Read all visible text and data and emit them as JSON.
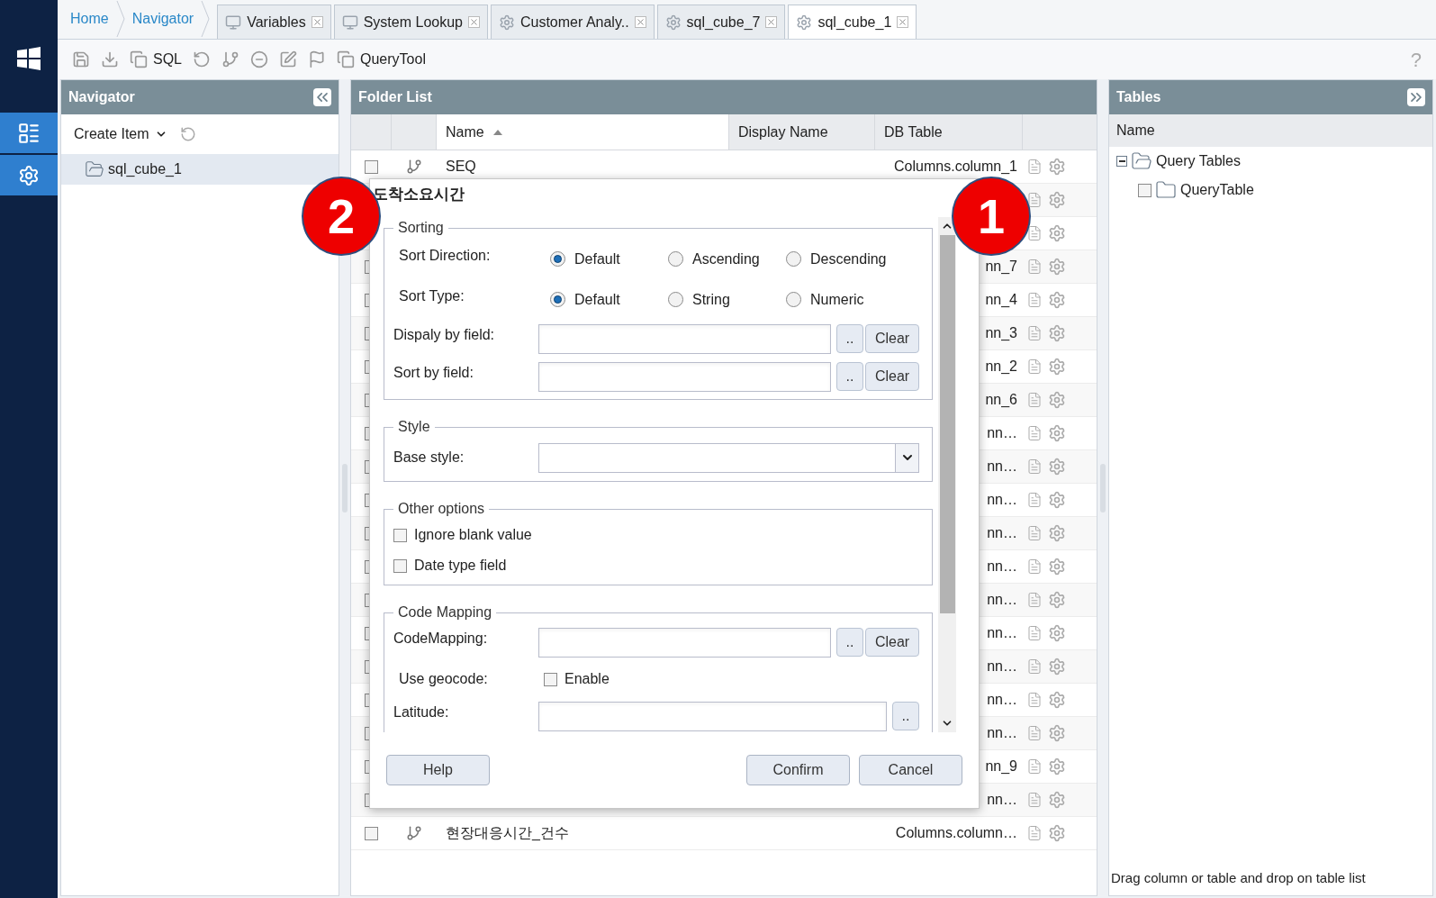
{
  "breadcrumb": [
    {
      "label": "Home"
    },
    {
      "label": "Navigator"
    }
  ],
  "tabs": [
    {
      "label": "Variables",
      "kind": "page",
      "selected": false
    },
    {
      "label": "System Lookup",
      "kind": "page",
      "selected": false
    },
    {
      "label": "Customer Analy..",
      "kind": "cube",
      "selected": false
    },
    {
      "label": "sql_cube_7",
      "kind": "cube",
      "selected": false
    },
    {
      "label": "sql_cube_1",
      "kind": "cube",
      "selected": true
    }
  ],
  "toolbar": {
    "sql_label": "SQL",
    "query_tool_label": "QueryTool",
    "help": "?"
  },
  "navigator": {
    "title": "Navigator",
    "create_item": "Create Item",
    "tree": [
      {
        "label": "sql_cube_1",
        "selected": true
      }
    ]
  },
  "folder_list": {
    "title": "Folder List",
    "columns": [
      "Name",
      "Display Name",
      "DB Table"
    ],
    "rows": [
      {
        "name": "SEQ",
        "db_table": "Columns.column_1",
        "checked": false
      },
      {},
      {},
      {
        "db_table": "nn_7",
        "checked": false
      },
      {
        "db_table": "nn_4",
        "checked": false
      },
      {
        "db_table": "nn_3",
        "checked": false
      },
      {
        "db_table": "nn_2",
        "checked": false
      },
      {
        "db_table": "nn_6",
        "checked": false
      },
      {
        "db_table": "nn…",
        "checked": false
      },
      {
        "db_table": "nn…",
        "checked": false
      },
      {
        "db_table": "nn…",
        "checked": false
      },
      {
        "db_table": "nn…",
        "checked": false
      },
      {
        "db_table": "nn…",
        "checked": false
      },
      {
        "db_table": "nn…",
        "checked": false
      },
      {
        "db_table": "nn…",
        "checked": false
      },
      {
        "db_table": "nn…",
        "checked": false
      },
      {
        "db_table": "nn…",
        "checked": false
      },
      {
        "db_table": "nn…",
        "checked": false
      },
      {
        "db_table": "nn_9",
        "checked": false
      },
      {
        "db_table": "nn…",
        "checked": false
      },
      {
        "name": "현장대응시간_건수",
        "db_table": "Columns.column…",
        "checked": false
      }
    ]
  },
  "tables": {
    "title": "Tables",
    "column": "Name",
    "tree": [
      {
        "label": "Query Tables",
        "expanded": true,
        "children": [
          {
            "label": "QueryTable",
            "expanded": false,
            "checked": false
          }
        ]
      }
    ],
    "footer": "Drag column or table and drop on table list"
  },
  "dialog": {
    "title": "도착소요시간",
    "sections": [
      {
        "legend": "Sorting",
        "rows": [
          {
            "kind": "radio",
            "label": "Sort Direction:",
            "options": [
              {
                "label": "Default",
                "selected": true
              },
              {
                "label": "Ascending",
                "selected": false
              },
              {
                "label": "Descending",
                "selected": false
              }
            ]
          },
          {
            "kind": "radio",
            "label": "Sort Type:",
            "options": [
              {
                "label": "Default",
                "selected": true
              },
              {
                "label": "String",
                "selected": false
              },
              {
                "label": "Numeric",
                "selected": false
              }
            ]
          },
          {
            "kind": "field",
            "label": "Dispaly by field:",
            "buttons": [
              "..",
              "Clear"
            ]
          },
          {
            "kind": "field",
            "label": "Sort by field:",
            "buttons": [
              "..",
              "Clear"
            ]
          }
        ]
      },
      {
        "legend": "Style",
        "rows": [
          {
            "kind": "select",
            "label": "Base style:"
          }
        ]
      },
      {
        "legend": "Other options",
        "rows": [
          {
            "kind": "checkbox",
            "label": "Ignore blank value",
            "checked": false
          },
          {
            "kind": "checkbox",
            "label": "Date type field",
            "checked": false
          }
        ]
      },
      {
        "legend": "Code Mapping",
        "rows": [
          {
            "kind": "field",
            "label": "CodeMapping:",
            "buttons": [
              "..",
              "Clear"
            ]
          },
          {
            "kind": "check_field",
            "label": "Use geocode:",
            "option": "Enable",
            "checked": false
          },
          {
            "kind": "field",
            "label": "Latitude:",
            "buttons": [
              ".."
            ]
          }
        ]
      }
    ],
    "buttons": [
      {
        "label": "Help",
        "kind": "left"
      },
      {
        "label": "Confirm",
        "kind": "right"
      },
      {
        "label": "Cancel",
        "kind": "right"
      }
    ]
  },
  "callouts": [
    {
      "label": "2"
    },
    {
      "label": "1"
    }
  ]
}
